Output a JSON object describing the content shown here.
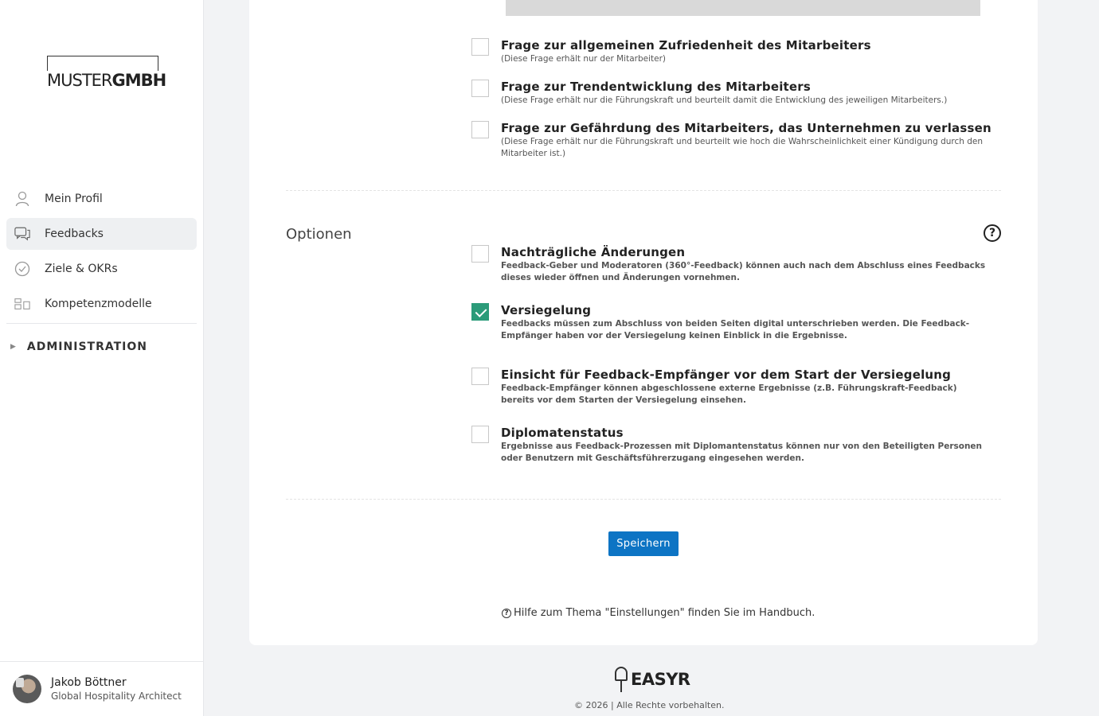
{
  "sidebar": {
    "logo": {
      "light": "MUSTER",
      "bold": "GMBH"
    },
    "nav": [
      {
        "label": "Mein Profil",
        "icon": "user-icon"
      },
      {
        "label": "Feedbacks",
        "icon": "chat-icon",
        "active": true
      },
      {
        "label": "Ziele & OKRs",
        "icon": "check-circle-icon"
      },
      {
        "label": "Kompetenzmodelle",
        "icon": "models-icon"
      }
    ],
    "admin": {
      "label": "ADMINISTRATION",
      "arrow": "▶"
    },
    "profile": {
      "name": "Jakob Böttner",
      "role": "Global Hospitality Architect"
    }
  },
  "questions": [
    {
      "title": "Frage zur allgemeinen Zufriedenheit des Mitarbeiters",
      "desc": "(Diese Frage erhält nur der Mitarbeiter)",
      "checked": false
    },
    {
      "title": "Frage zur Trendentwicklung des Mitarbeiters",
      "desc": "(Diese Frage erhält nur die Führungskraft und beurteilt damit die Entwicklung des jeweiligen Mitarbeiters.)",
      "checked": false
    },
    {
      "title": "Frage zur Gefährdung des Mitarbeiters, das Unternehmen zu verlassen",
      "desc": "(Diese Frage erhält nur die Führungskraft und beurteilt wie hoch die Wahrscheinlichkeit einer Kündigung durch den Mitarbeiter ist.)",
      "checked": false
    }
  ],
  "options_section": {
    "label": "Optionen",
    "help_glyph": "?",
    "items": [
      {
        "title": "Nachträgliche Änderungen",
        "desc": "Feedback-Geber und Moderatoren (360°-Feedback) können auch nach dem Abschluss eines Feedbacks dieses wieder öffnen und Änderungen vornehmen.",
        "checked": false
      },
      {
        "title": "Versiegelung",
        "desc": "Feedbacks müssen zum Abschluss von beiden Seiten digital unterschrieben werden. Die Feedback-Empfänger haben vor der Versiegelung keinen Einblick in die Ergebnisse.",
        "checked": true
      },
      {
        "title": "Einsicht für Feedback-Empfänger vor dem Start der Versiegelung",
        "desc": "Feedback-Empfänger können abgeschlossene externe Ergebnisse (z.B. Führungskraft-Feedback) bereits vor dem Starten der Versiegelung einsehen.",
        "checked": false
      },
      {
        "title": "Diplomatenstatus",
        "desc": "Ergebnisse aus Feedback-Prozessen mit Diplomantenstatus können nur von den Beteiligten Personen oder Benutzern mit Geschäftsführerzugang eingesehen werden.",
        "checked": false
      }
    ]
  },
  "save_label": "Speichern",
  "help_text": "Hilfe zum Thema \"Einstellungen\" finden Sie im Handbuch.",
  "footer": {
    "brand": "EASYR",
    "copyright": "© 2026 | Alle Rechte vorbehalten."
  },
  "colors": {
    "accent": "#0d74c4",
    "checked": "#2b9b79"
  }
}
